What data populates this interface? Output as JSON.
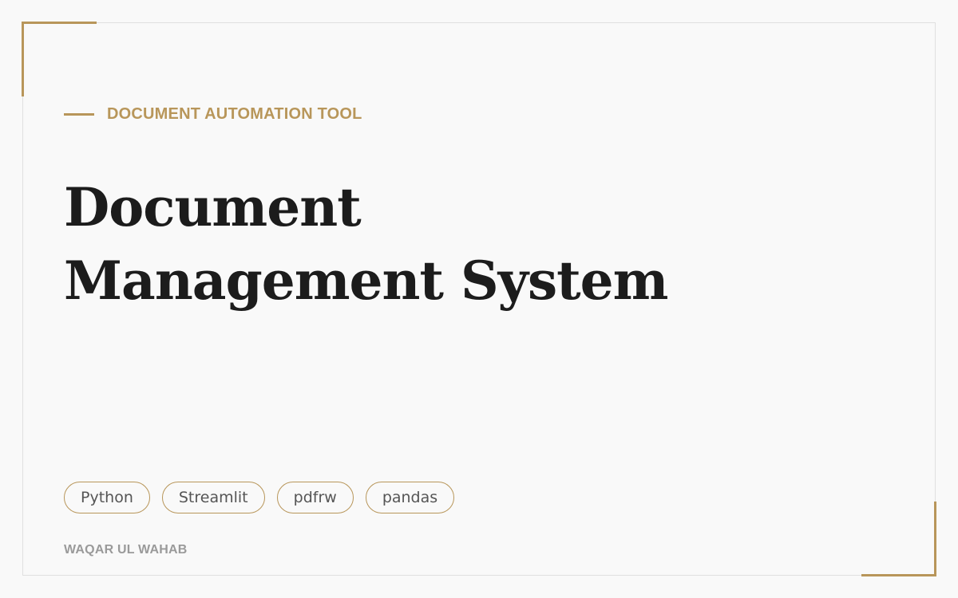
{
  "eyebrow": "DOCUMENT AUTOMATION TOOL",
  "title": {
    "line1": "Document",
    "line2": "Management System"
  },
  "tags": [
    "Python",
    "Streamlit",
    "pdfrw",
    "pandas"
  ],
  "author": "WAQAR UL WAHAB",
  "colors": {
    "accent": "#b8965a",
    "title": "#1c1c1c",
    "background": "#f9f9f9",
    "muted": "#9a9a9a"
  }
}
